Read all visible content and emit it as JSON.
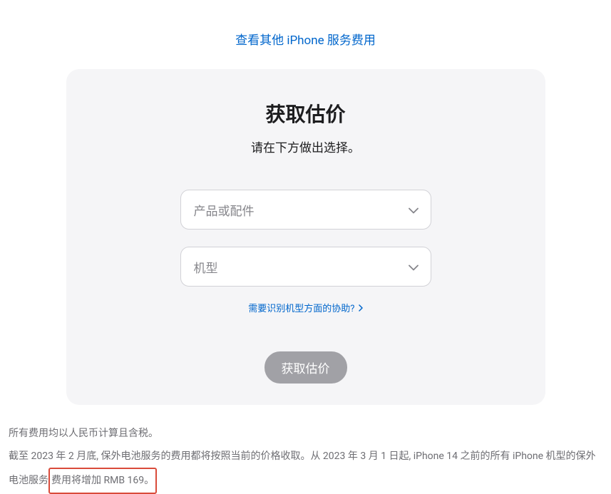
{
  "top_link": {
    "label": "查看其他 iPhone 服务费用"
  },
  "card": {
    "title": "获取估价",
    "subtitle": "请在下方做出选择。",
    "select_product": {
      "placeholder": "产品或配件"
    },
    "select_model": {
      "placeholder": "机型"
    },
    "help_link": {
      "label": "需要识别机型方面的协助?"
    },
    "submit_button": {
      "label": "获取估价"
    }
  },
  "footer": {
    "line1": "所有费用均以人民币计算且含税。",
    "line2_part1": "截至 2023 年 2 月底, 保外电池服务的费用都将按照当前的价格收取。从 2023 年 3 月 1 日起, iPhone 14 之前的所有 iPhone 机型的保外电池服务",
    "line2_highlight": "费用将增加 RMB 169。"
  }
}
